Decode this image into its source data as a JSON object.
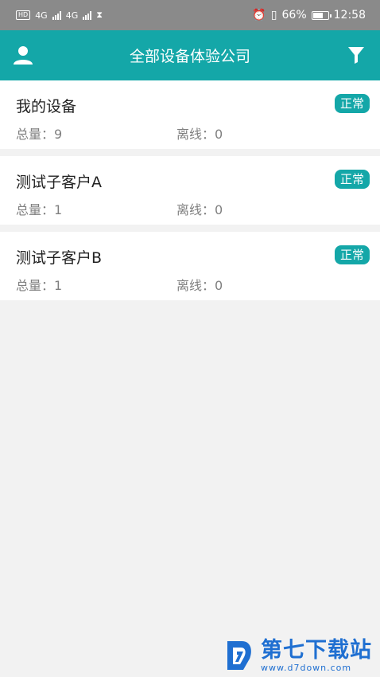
{
  "status_bar": {
    "hd_badge": "HD",
    "signal1": "4G",
    "signal2": "4G",
    "battery": "66%",
    "time": "12:58"
  },
  "app_bar": {
    "title": "全部设备体验公司",
    "user_icon": "person-icon",
    "filter_icon": "filter-funnel-icon",
    "bg_color": "#14a7a8"
  },
  "devices": [
    {
      "name": "我的设备",
      "total": "总量：9",
      "offline": "离线：0",
      "status": "正常"
    },
    {
      "name": "测试子客户A",
      "total": "总量：1",
      "offline": "离线：0",
      "status": "正常"
    },
    {
      "name": "测试子客户B",
      "total": "总量：1",
      "offline": "离线：0",
      "status": "正常"
    }
  ],
  "watermark": {
    "name": "第七下载站",
    "url": "www.d7down.com"
  }
}
